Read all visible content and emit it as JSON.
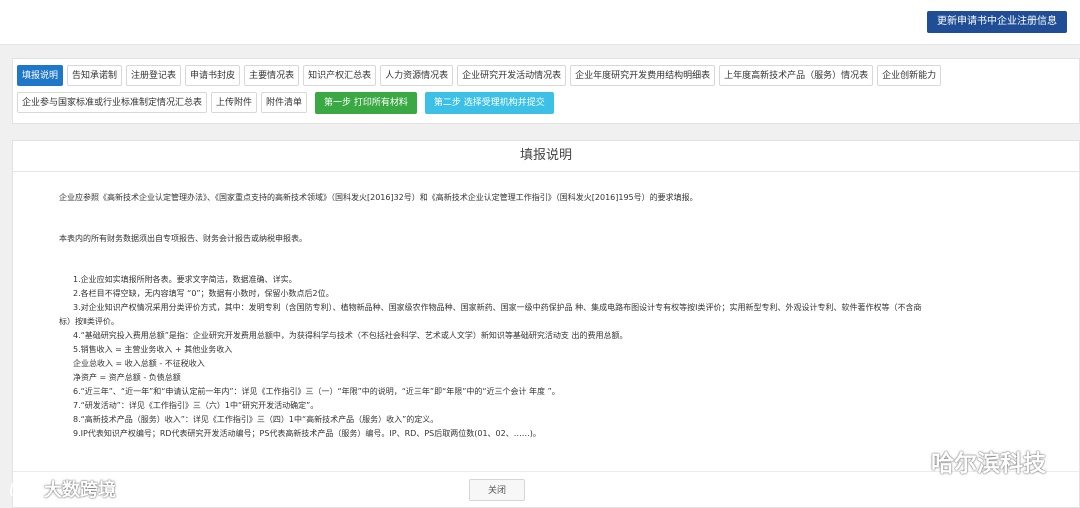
{
  "header": {
    "update_button": "更新申请书中企业注册信息"
  },
  "tabs_row1": [
    "填报说明",
    "告知承诺制",
    "注册登记表",
    "申请书封皮",
    "主要情况表",
    "知识产权汇总表",
    "人力资源情况表",
    "企业研究开发活动情况表",
    "企业年度研究开发费用结构明细表",
    "上年度高新技术产品（服务）情况表",
    "企业创新能力"
  ],
  "tabs_row2": [
    "企业参与国家标准或行业标准制定情况汇总表",
    "上传附件",
    "附件清单"
  ],
  "steps": {
    "step1": "第一步 打印所有材料",
    "step2": "第二步 选择受理机构并提交"
  },
  "panel": {
    "title": "填报说明",
    "para1": "企业应参照《高新技术企业认定管理办法》、《国家重点支持的高新技术领域》（国科发火[2016]32号）和《高新技术企业认定管理工作指引》（国科发火[2016]195号）的要求填报。",
    "para2": "本表内的所有财务数据须出自专项报告、财务会计报告或纳税申报表。",
    "items": [
      "1.企业应如实填报所附各表。要求文字简洁，数据准确、详实。",
      "2.各栏目不得空缺，无内容填写 “0”；数据有小数时，保留小数点后2位。",
      "3.对企业知识产权情况采用分类评价方式，其中：发明专利（含国防专利）、植物新品种、国家级农作物品种、国家新药、国家一级中药保护品 种、集成电路布图设计专有权等按Ⅰ类评价；实用新型专利、外观设计专利、软件著作权等（不含商",
      "标）按Ⅱ类评价。",
      "4.“基础研究投入费用总额”是指：企业研究开发费用总额中，为获得科学与技术（不包括社会科学、艺术或人文学）新知识等基础研究活动支 出的费用总额。",
      "5.销售收入 = 主营业务收入 + 其他业务收入",
      "企业总收入 = 收入总额 - 不征税收入",
      "净资产 = 资产总额 - 负债总额",
      "6.“近三年”、“近一年”和“申请认定前一年内”：详见《工作指引》三（一）“年限”中的说明，“近三年”即“年限”中的“近三个会计 年度 ”。",
      "7.“研发活动”：详见《工作指引》三（六）1中“研究开发活动确定”。",
      "8.“高新技术产品（服务）收入”：详见《工作指引》三（四）1中“高新技术产品（服务）收入”的定义。",
      "9.IP代表知识产权编号；RD代表研究开发活动编号；PS代表高新技术产品（服务）编号。IP、RD、PS后取两位数(01、02、……)。"
    ],
    "close_button": "关闭"
  },
  "watermarks": {
    "right": "哈尔滨科技",
    "left": "大数跨境"
  }
}
